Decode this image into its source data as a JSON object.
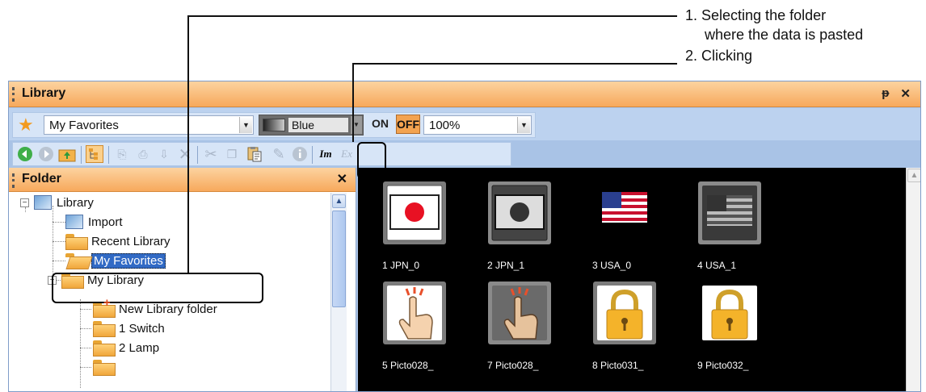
{
  "callouts": {
    "step1_line1": "1. Selecting the folder",
    "step1_line2": "where the data is pasted",
    "step2": "2. Clicking"
  },
  "window": {
    "title": "Library",
    "pin_icon": "pin-icon",
    "close_icon": "close-icon"
  },
  "toolbar": {
    "favorites_value": "My Favorites",
    "color_value": "Blue",
    "on_label": "ON",
    "off_label": "OFF",
    "zoom_value": "100%",
    "icons": [
      "back-icon",
      "forward-icon",
      "up-folder-icon",
      "folder-tree-icon",
      "new-item-icon",
      "new-folder-icon",
      "import-icon",
      "delete-icon",
      "cut-icon",
      "copy-icon",
      "paste-icon",
      "edit-icon",
      "info-icon",
      "import-library-icon",
      "export-library-icon"
    ]
  },
  "folder_pane": {
    "title": "Folder",
    "items": [
      {
        "label": "Library"
      },
      {
        "label": "Import"
      },
      {
        "label": "Recent Library"
      },
      {
        "label": "My Favorites"
      },
      {
        "label": "My Library"
      },
      {
        "label": "New Library folder"
      },
      {
        "label": "1 Switch"
      },
      {
        "label": "2 Lamp"
      }
    ]
  },
  "preview": {
    "items": [
      {
        "label": "1 JPN_0",
        "icon": "japan-flag-icon"
      },
      {
        "label": "2 JPN_1",
        "icon": "japan-flag-dark-icon"
      },
      {
        "label": "3 USA_0",
        "icon": "usa-flag-icon"
      },
      {
        "label": "4 USA_1",
        "icon": "usa-flag-dark-icon"
      },
      {
        "label": "5 Picto028_",
        "icon": "hand-touch-icon"
      },
      {
        "label": "7 Picto028_",
        "icon": "hand-touch-dark-icon"
      },
      {
        "label": "8 Picto031_",
        "icon": "padlock-icon"
      },
      {
        "label": "9 Picto032_",
        "icon": "padlock-icon"
      }
    ]
  },
  "colors": {
    "title_bar": "#f7a95c",
    "selection": "#316ac5",
    "preview_bg": "#000000",
    "window_bg": "#a9c3e6"
  }
}
